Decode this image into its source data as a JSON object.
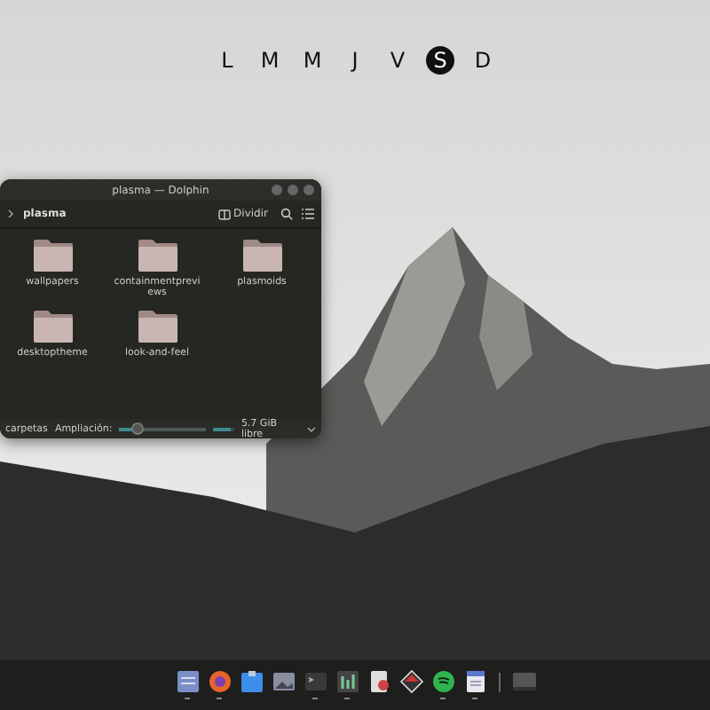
{
  "calendar_strip": {
    "days": [
      {
        "label": "L",
        "selected": false
      },
      {
        "label": "M",
        "selected": false
      },
      {
        "label": "M",
        "selected": false
      },
      {
        "label": "J",
        "selected": false
      },
      {
        "label": "V",
        "selected": false
      },
      {
        "label": "S",
        "selected": true
      },
      {
        "label": "D",
        "selected": false
      }
    ]
  },
  "window": {
    "title": "plasma — Dolphin",
    "breadcrumb": "plasma",
    "split_button": "Dividir",
    "items": [
      {
        "name": "wallpapers"
      },
      {
        "name": "containmentpreviews"
      },
      {
        "name": "plasmoids"
      },
      {
        "name": "desktoptheme"
      },
      {
        "name": "look-and-feel"
      }
    ],
    "status": {
      "folders": "carpetas",
      "zoom_label": "Ampliación:",
      "zoom": {
        "level": 0.2
      },
      "storage": {
        "level": 0.8
      },
      "free": "5.7 GiB libre"
    }
  },
  "dock": {
    "items": [
      {
        "kind": "launcher",
        "running": true
      },
      {
        "kind": "browser",
        "running": true
      },
      {
        "kind": "files",
        "running": false
      },
      {
        "kind": "photos",
        "running": false
      },
      {
        "kind": "terminal",
        "running": true
      },
      {
        "kind": "mixer",
        "running": true
      },
      {
        "kind": "document",
        "running": false
      },
      {
        "kind": "vector",
        "running": false
      },
      {
        "kind": "music",
        "running": true
      },
      {
        "kind": "notes",
        "running": true
      },
      {
        "kind": "desktop",
        "running": false
      }
    ]
  }
}
